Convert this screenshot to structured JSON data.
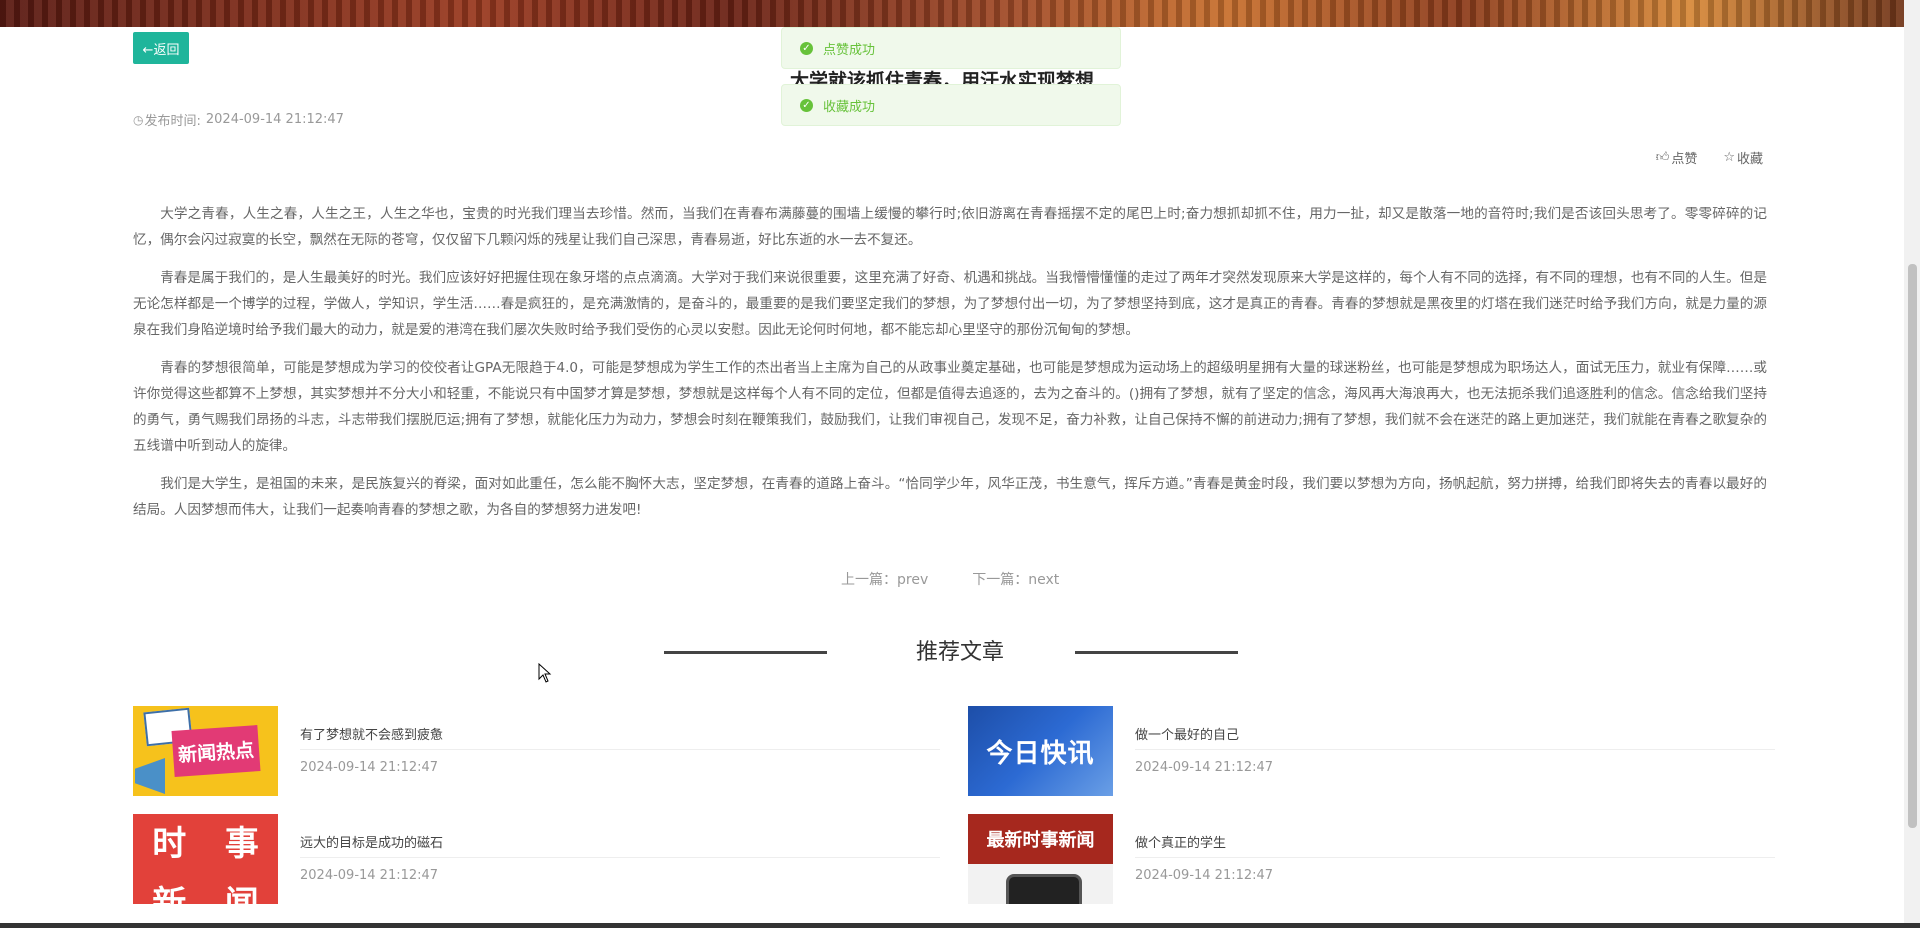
{
  "header": {
    "back_label": "←返回",
    "title": "大学就该抓住青春，用汗水实现梦想"
  },
  "toasts": [
    {
      "icon": "success-check-icon",
      "text": "点赞成功"
    },
    {
      "icon": "success-check-icon",
      "text": "收藏成功"
    }
  ],
  "meta": {
    "publish_icon": "clock-icon",
    "publish_label": "发布时间:",
    "publish_time": "2024-09-14 21:12:47"
  },
  "actions": {
    "like_label": "点赞",
    "favorite_label": "收藏"
  },
  "article": {
    "paragraphs": [
      "大学之青春，人生之春，人生之王，人生之华也，宝贵的时光我们理当去珍惜。然而，当我们在青春布满藤蔓的围墙上缓慢的攀行时;依旧游离在青春摇摆不定的尾巴上时;奋力想抓却抓不住，用力一扯，却又是散落一地的音符时;我们是否该回头思考了。零零碎碎的记忆，偶尔会闪过寂寞的长空，飘然在无际的苍穹，仅仅留下几颗闪烁的残星让我们自己深思，青春易逝，好比东逝的水一去不复还。",
      "青春是属于我们的，是人生最美好的时光。我们应该好好把握住现在象牙塔的点点滴滴。大学对于我们来说很重要，这里充满了好奇、机遇和挑战。当我懵懵懂懂的走过了两年才突然发现原来大学是这样的，每个人有不同的选择，有不同的理想，也有不同的人生。但是无论怎样都是一个博学的过程，学做人，学知识，学生活……春是疯狂的，是充满激情的，是奋斗的，最重要的是我们要坚定我们的梦想，为了梦想付出一切，为了梦想坚持到底，这才是真正的青春。青春的梦想就是黑夜里的灯塔在我们迷茫时给予我们方向，就是力量的源泉在我们身陷逆境时给予我们最大的动力，就是爱的港湾在我们屡次失败时给予我们受伤的心灵以安慰。因此无论何时何地，都不能忘却心里坚守的那份沉甸甸的梦想。",
      "青春的梦想很简单，可能是梦想成为学习的佼佼者让GPA无限趋于4.0，可能是梦想成为学生工作的杰出者当上主席为自己的从政事业奠定基础，也可能是梦想成为运动场上的超级明星拥有大量的球迷粉丝，也可能是梦想成为职场达人，面试无压力，就业有保障……或许你觉得这些都算不上梦想，其实梦想并不分大小和轻重，不能说只有中国梦才算是梦想，梦想就是这样每个人有不同的定位，但都是值得去追逐的，去为之奋斗的。()拥有了梦想，就有了坚定的信念，海风再大海浪再大，也无法扼杀我们追逐胜利的信念。信念给我们坚持的勇气，勇气赐我们昂扬的斗志，斗志带我们摆脱厄运;拥有了梦想，就能化压力为动力，梦想会时刻在鞭策我们，鼓励我们，让我们审视自己，发现不足，奋力补救，让自己保持不懈的前进动力;拥有了梦想，我们就不会在迷茫的路上更加迷茫，我们就能在青春之歌复杂的五线谱中听到动人的旋律。",
      "我们是大学生，是祖国的未来，是民族复兴的脊梁，面对如此重任，怎么能不胸怀大志，坚定梦想，在青春的道路上奋斗。“恰同学少年，风华正茂，书生意气，挥斥方遒。”青春是黄金时段，我们要以梦想为方向，扬帆起航，努力拼搏，给我们即将失去的青春以最好的结局。人因梦想而伟大，让我们一起奏响青春的梦想之歌，为各自的梦想努力进发吧!"
    ]
  },
  "navigation": {
    "prev": "上一篇：prev",
    "next": "下一篇：next"
  },
  "recommend": {
    "title": "推荐文章",
    "items": [
      {
        "title": "有了梦想就不会感到疲惫",
        "date": "2024-09-14 21:12:47",
        "thumb_text": "新闻热点"
      },
      {
        "title": "做一个最好的自己",
        "date": "2024-09-14 21:12:47",
        "thumb_text": "今日快讯"
      },
      {
        "title": "远大的目标是成功的磁石",
        "date": "2024-09-14 21:12:47",
        "thumb_text": "时事新闻"
      },
      {
        "title": "做个真正的学生",
        "date": "2024-09-14 21:12:47",
        "thumb_text": "最新时事新闻"
      }
    ]
  },
  "colors": {
    "accent": "#1fb59b",
    "toast_bg": "#f0f9eb",
    "toast_text": "#67c23a"
  }
}
